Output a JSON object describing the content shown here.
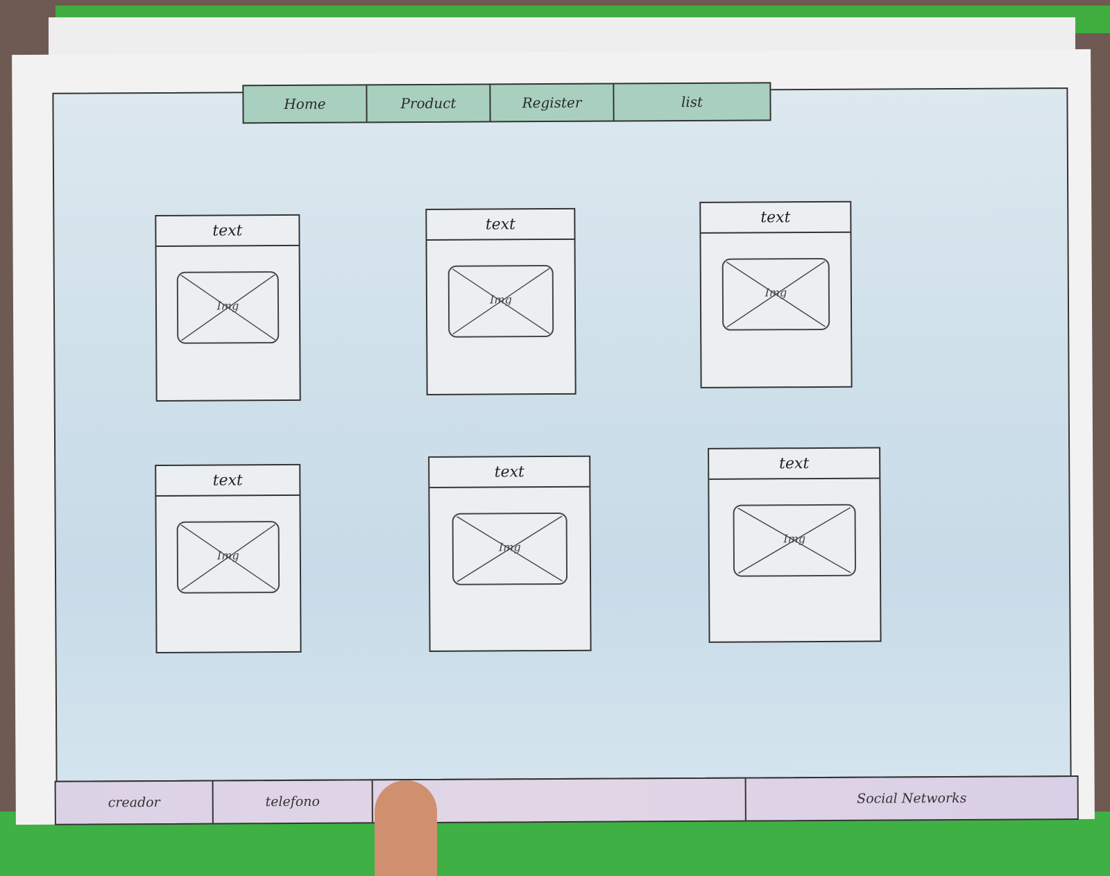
{
  "nav": {
    "items": [
      {
        "label": "Home"
      },
      {
        "label": "Product"
      },
      {
        "label": "Register"
      },
      {
        "label": "list"
      }
    ]
  },
  "cards": [
    {
      "title": "text",
      "image_label": "Img"
    },
    {
      "title": "text",
      "image_label": "Img"
    },
    {
      "title": "text",
      "image_label": "Img"
    },
    {
      "title": "text",
      "image_label": "Img"
    },
    {
      "title": "text",
      "image_label": "Img"
    },
    {
      "title": "text",
      "image_label": "Img"
    }
  ],
  "footer": {
    "creator": "creador",
    "phone": "telefono",
    "social": "Social Networks"
  },
  "colors": {
    "nav": "#a9d0bf",
    "background": "#cfe0ea",
    "footer": "#dcd2e6"
  }
}
